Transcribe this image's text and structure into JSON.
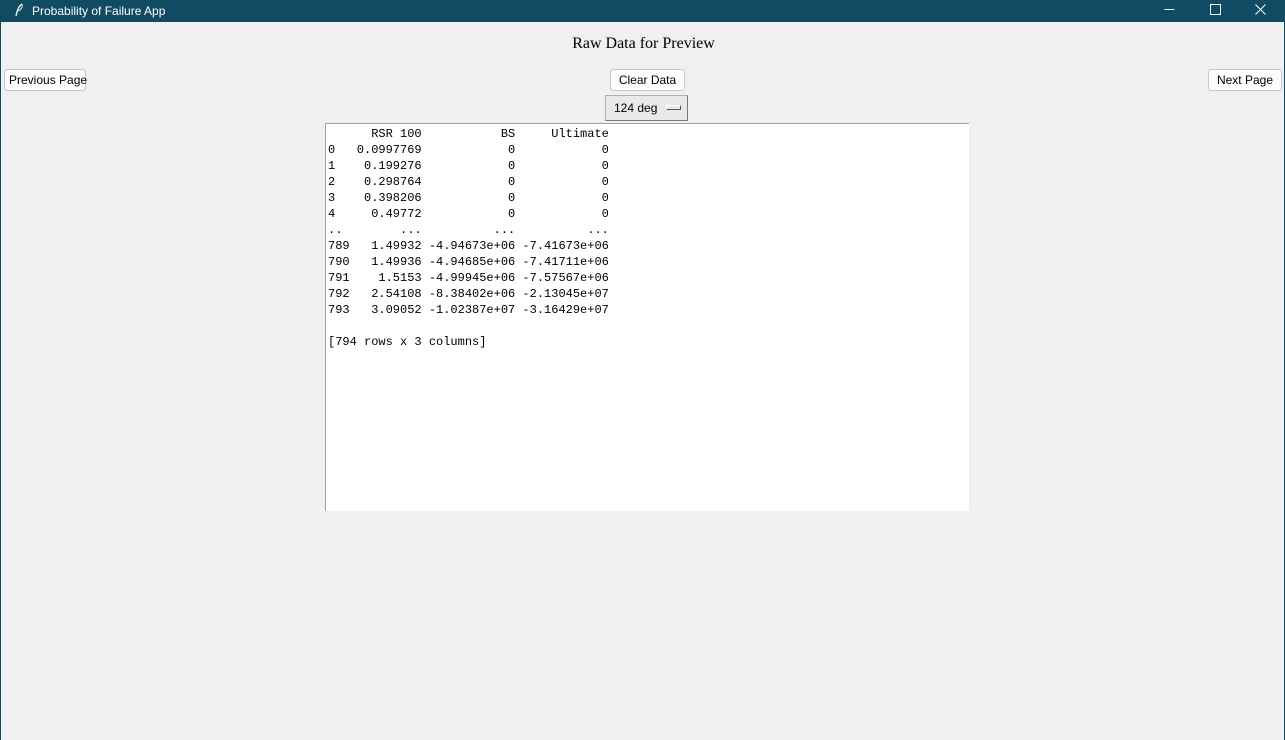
{
  "window": {
    "title": "Probability of Failure App",
    "controls": {
      "minimize": "minimize-icon",
      "maximize": "maximize-icon",
      "close": "close-icon"
    },
    "titlebar_color": "#114b63"
  },
  "header": {
    "title": "Raw Data for Preview"
  },
  "navigation": {
    "previous_label": "Previous Page",
    "clear_label": "Clear Data",
    "next_label": "Next Page"
  },
  "selector": {
    "value": "124 deg"
  },
  "preview": {
    "lines": [
      "      RSR 100           BS     Ultimate",
      "0   0.0997769            0            0",
      "1    0.199276            0            0",
      "2    0.298764            0            0",
      "3    0.398206            0            0",
      "4     0.49772            0            0",
      "..        ...          ...          ...",
      "789   1.49932 -4.94673e+06 -7.41673e+06",
      "790   1.49936 -4.94685e+06 -7.41711e+06",
      "791    1.5153 -4.99945e+06 -7.57567e+06",
      "792   2.54108 -8.38402e+06 -2.13045e+07",
      "793   3.09052 -1.02387e+07 -3.16429e+07",
      "",
      "[794 rows x 3 columns]"
    ]
  }
}
